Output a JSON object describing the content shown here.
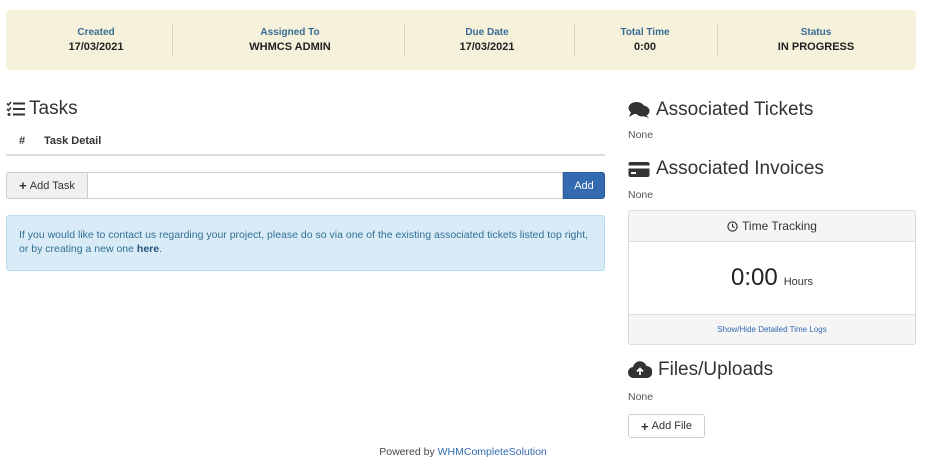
{
  "summary": {
    "created": {
      "label": "Created",
      "value": "17/03/2021"
    },
    "assigned": {
      "label": "Assigned To",
      "value": "WHMCS ADMIN"
    },
    "due": {
      "label": "Due Date",
      "value": "17/03/2021"
    },
    "total_time": {
      "label": "Total Time",
      "value": "0:00"
    },
    "status": {
      "label": "Status",
      "value": "IN PROGRESS"
    }
  },
  "tasks": {
    "title": "Tasks",
    "col_num": "#",
    "col_detail": "Task Detail",
    "add_label": "Add Task",
    "input_value": "",
    "add_button": "Add"
  },
  "info": {
    "text_before": "If you would like to contact us regarding your project, please do so via one of the existing associated tickets listed top right, or by creating a new one ",
    "link": "here",
    "text_after": "."
  },
  "tickets": {
    "title": "Associated Tickets",
    "none": "None"
  },
  "invoices": {
    "title": "Associated Invoices",
    "none": "None"
  },
  "time_tracking": {
    "title": "Time Tracking",
    "value": "0:00",
    "unit": "Hours",
    "toggle_link": "Show/Hide Detailed Time Logs"
  },
  "files": {
    "title": "Files/Uploads",
    "none": "None",
    "add_button": "Add File"
  },
  "footer": {
    "prefix": "Powered by ",
    "link": "WHMCompleteSolution"
  },
  "colors": {
    "summary_bg": "#f5f1da",
    "accent": "#336ab0",
    "info_bg": "#d9ebf6"
  }
}
